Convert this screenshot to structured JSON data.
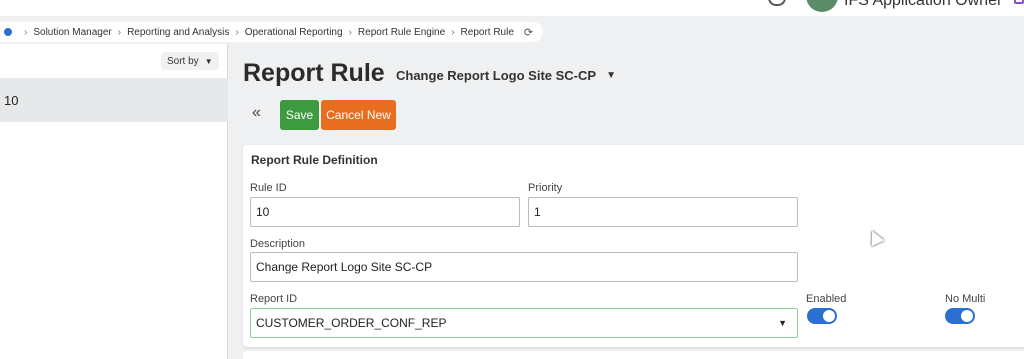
{
  "header": {
    "user_label": "IFS Application Owner"
  },
  "breadcrumb": {
    "items": [
      "Solution Manager",
      "Reporting and Analysis",
      "Operational Reporting",
      "Report Rule Engine",
      "Report Rule"
    ]
  },
  "list_panel": {
    "sort_label": "Sort by",
    "selected_item": "10"
  },
  "page": {
    "title": "Report Rule",
    "record_title": "Change Report Logo Site SC-CP"
  },
  "toolbar": {
    "save_label": "Save",
    "cancel_label": "Cancel New"
  },
  "form": {
    "section_title": "Report Rule Definition",
    "rule_id_label": "Rule ID",
    "rule_id_value": "10",
    "priority_label": "Priority",
    "priority_value": "1",
    "description_label": "Description",
    "description_value": "Change Report Logo Site SC-CP",
    "report_id_label": "Report ID",
    "report_id_value": "CUSTOMER_ORDER_CONF_REP",
    "enabled_label": "Enabled",
    "enabled_value": true,
    "no_multi_label": "No Multi",
    "no_multi_value": true
  },
  "colors": {
    "save": "#3e9a3e",
    "cancel": "#e96d1f",
    "toggle_on": "#2a6fd1",
    "breadcrumb_home": "#2a6fd1"
  }
}
